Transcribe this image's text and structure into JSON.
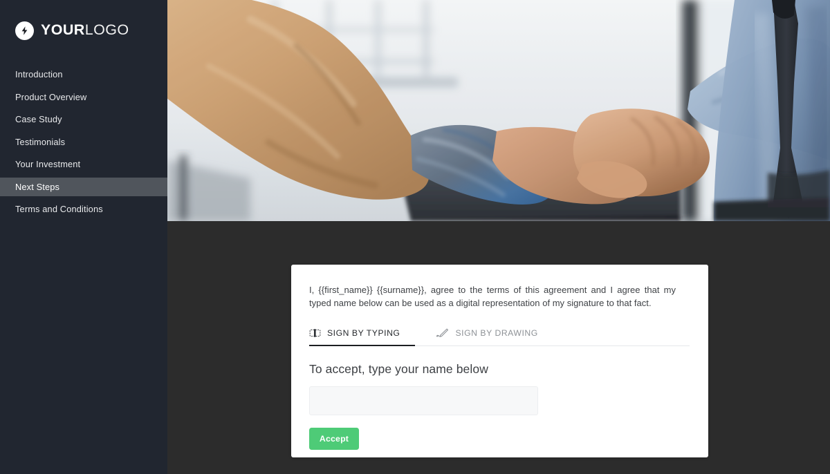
{
  "brand": {
    "logo_icon": "lightning-bolt-icon",
    "name_bold": "YOUR",
    "name_light": "LOGO"
  },
  "sidebar": {
    "items": [
      {
        "label": "Introduction",
        "active": false
      },
      {
        "label": "Product Overview",
        "active": false
      },
      {
        "label": "Case Study",
        "active": false
      },
      {
        "label": "Testimonials",
        "active": false
      },
      {
        "label": "Your Investment",
        "active": false
      },
      {
        "label": "Next Steps",
        "active": true
      },
      {
        "label": "Terms and Conditions",
        "active": false
      }
    ],
    "background_color": "#212630",
    "active_background_color": "#50555c"
  },
  "hero": {
    "alt": "Two people shaking hands in an office by a window",
    "description": "handshake-photo"
  },
  "card": {
    "agreement_text": "I, {{first_name}} {{surname}}, agree to the terms of this agreement and I agree that my typed name below can be used as a digital representation of my signature to that fact.",
    "tabs": [
      {
        "label": "SIGN BY TYPING",
        "icon": "keyboard-icon",
        "active": true
      },
      {
        "label": "SIGN BY DRAWING",
        "icon": "pen-icon",
        "active": false
      }
    ],
    "form": {
      "heading": "To accept, type your name below",
      "input_value": "",
      "input_placeholder": "",
      "submit_label": "Accept",
      "submit_color": "#4ecb77"
    }
  },
  "theme": {
    "page_background": "#2c2c2c",
    "card_background": "#ffffff"
  }
}
